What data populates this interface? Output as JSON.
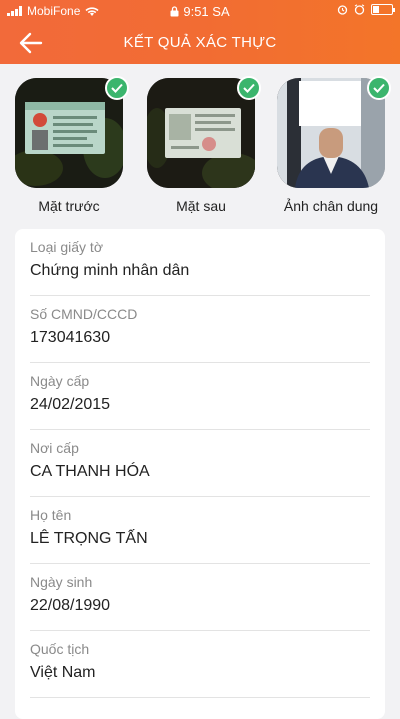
{
  "status_bar": {
    "carrier": "MobiFone",
    "time": "9:51 SA"
  },
  "header": {
    "title": "KẾT QUẢ XÁC THỰC"
  },
  "photos": [
    {
      "label": "Mặt trước",
      "verified": true
    },
    {
      "label": "Mặt sau",
      "verified": true
    },
    {
      "label": "Ảnh chân dung",
      "verified": true
    }
  ],
  "fields": [
    {
      "key": "Loại giấy tờ",
      "value": "Chứng minh nhân dân"
    },
    {
      "key": "Số CMND/CCCD",
      "value": "173041630"
    },
    {
      "key": "Ngày cấp",
      "value": "24/02/2015"
    },
    {
      "key": "Nơi cấp",
      "value": "CA THANH HÓA"
    },
    {
      "key": "Họ tên",
      "value": "LÊ TRỌNG TẤN"
    },
    {
      "key": "Ngày sinh",
      "value": "22/08/1990"
    },
    {
      "key": "Quốc tịch",
      "value": "Việt Nam"
    }
  ],
  "colors": {
    "header_orange": "#f26c33",
    "check_green": "#3bb56d"
  },
  "icons": [
    "signal-icon",
    "wifi-icon",
    "lock-icon",
    "alarm-icon",
    "battery-icon",
    "back-arrow-icon",
    "check-icon"
  ]
}
